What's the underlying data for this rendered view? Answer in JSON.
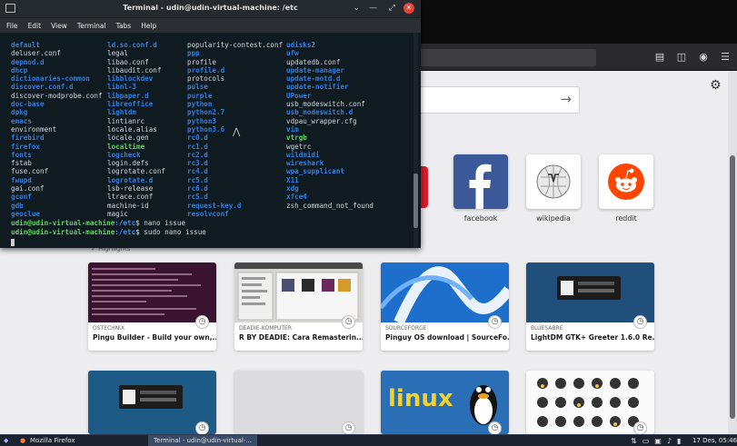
{
  "terminal": {
    "title": "Terminal - udin@udin-virtual-machine: /etc",
    "menu": [
      "File",
      "Edit",
      "View",
      "Terminal",
      "Tabs",
      "Help"
    ],
    "columns": [
      [
        {
          "t": "default",
          "k": "d"
        },
        {
          "t": "deluser.conf",
          "k": "n"
        },
        {
          "t": "depmod.d",
          "k": "d"
        },
        {
          "t": "dhcp",
          "k": "d"
        },
        {
          "t": "dictionaries-common",
          "k": "d"
        },
        {
          "t": "discover.conf.d",
          "k": "d"
        },
        {
          "t": "discover-modprobe.conf",
          "k": "n"
        },
        {
          "t": "doc-base",
          "k": "d"
        },
        {
          "t": "dpkg",
          "k": "d"
        },
        {
          "t": "emacs",
          "k": "d"
        },
        {
          "t": "environment",
          "k": "n"
        },
        {
          "t": "firebird",
          "k": "d"
        },
        {
          "t": "firefox",
          "k": "d"
        },
        {
          "t": "fonts",
          "k": "d"
        },
        {
          "t": "fstab",
          "k": "n"
        },
        {
          "t": "fuse.conf",
          "k": "n"
        },
        {
          "t": "fwupd",
          "k": "d"
        },
        {
          "t": "gai.conf",
          "k": "n"
        },
        {
          "t": "gconf",
          "k": "d"
        },
        {
          "t": "gdb",
          "k": "d"
        },
        {
          "t": "geoclue",
          "k": "d"
        }
      ],
      [
        {
          "t": "ld.so.conf.d",
          "k": "d"
        },
        {
          "t": "legal",
          "k": "n"
        },
        {
          "t": "libao.conf",
          "k": "n"
        },
        {
          "t": "libaudit.conf",
          "k": "n"
        },
        {
          "t": "libblockdev",
          "k": "d"
        },
        {
          "t": "libnl-3",
          "k": "d"
        },
        {
          "t": "libpaper.d",
          "k": "d"
        },
        {
          "t": "libreoffice",
          "k": "d"
        },
        {
          "t": "lightdm",
          "k": "d"
        },
        {
          "t": "lintianrc",
          "k": "n"
        },
        {
          "t": "locale.alias",
          "k": "n"
        },
        {
          "t": "locale.gen",
          "k": "n"
        },
        {
          "t": "localtime",
          "k": "x"
        },
        {
          "t": "logcheck",
          "k": "d"
        },
        {
          "t": "login.defs",
          "k": "n"
        },
        {
          "t": "logrotate.conf",
          "k": "n"
        },
        {
          "t": "logrotate.d",
          "k": "d"
        },
        {
          "t": "lsb-release",
          "k": "n"
        },
        {
          "t": "ltrace.conf",
          "k": "n"
        },
        {
          "t": "machine-id",
          "k": "n"
        },
        {
          "t": "magic",
          "k": "n"
        }
      ],
      [
        {
          "t": "popularity-contest.conf",
          "k": "n"
        },
        {
          "t": "ppp",
          "k": "d"
        },
        {
          "t": "profile",
          "k": "n"
        },
        {
          "t": "profile.d",
          "k": "d"
        },
        {
          "t": "protocols",
          "k": "n"
        },
        {
          "t": "pulse",
          "k": "d"
        },
        {
          "t": "purple",
          "k": "d"
        },
        {
          "t": "python",
          "k": "d"
        },
        {
          "t": "python2.7",
          "k": "d"
        },
        {
          "t": "python3",
          "k": "d"
        },
        {
          "t": "python3.6",
          "k": "d"
        },
        {
          "t": "rc0.d",
          "k": "d"
        },
        {
          "t": "rc1.d",
          "k": "d"
        },
        {
          "t": "rc2.d",
          "k": "d"
        },
        {
          "t": "rc3.d",
          "k": "d"
        },
        {
          "t": "rc4.d",
          "k": "d"
        },
        {
          "t": "rc5.d",
          "k": "d"
        },
        {
          "t": "rc6.d",
          "k": "d"
        },
        {
          "t": "rcS.d",
          "k": "d"
        },
        {
          "t": "request-key.d",
          "k": "d"
        },
        {
          "t": "resolvconf",
          "k": "d"
        }
      ],
      [
        {
          "t": "udisks2",
          "k": "d"
        },
        {
          "t": "ufw",
          "k": "d"
        },
        {
          "t": "updatedb.conf",
          "k": "n"
        },
        {
          "t": "update-manager",
          "k": "d"
        },
        {
          "t": "update-motd.d",
          "k": "d"
        },
        {
          "t": "update-notifier",
          "k": "d"
        },
        {
          "t": "UPower",
          "k": "d"
        },
        {
          "t": "usb_modeswitch.conf",
          "k": "n"
        },
        {
          "t": "usb_modeswitch.d",
          "k": "d"
        },
        {
          "t": "vdpau_wrapper.cfg",
          "k": "n"
        },
        {
          "t": "vim",
          "k": "d"
        },
        {
          "t": "vtrgb",
          "k": "x"
        },
        {
          "t": "wgetrc",
          "k": "n"
        },
        {
          "t": "wildmidi",
          "k": "d"
        },
        {
          "t": "wireshark",
          "k": "d"
        },
        {
          "t": "wpa_supplicant",
          "k": "d"
        },
        {
          "t": "X11",
          "k": "d"
        },
        {
          "t": "xdg",
          "k": "d"
        },
        {
          "t": "xfce4",
          "k": "d"
        },
        {
          "t": "zsh_command_not_found",
          "k": "n"
        },
        {
          "t": "",
          "k": "n"
        }
      ]
    ],
    "prompts": [
      {
        "user": "udin@udin-virtual-machine",
        "path": ":/etc",
        "cmd": "$ nano issue"
      },
      {
        "user": "udin@udin-virtual-machine",
        "path": ":/etc",
        "cmd": "$ sudo nano issue"
      }
    ]
  },
  "firefox": {
    "top_sites": [
      {
        "label": "facebook"
      },
      {
        "label": "wikipedia"
      },
      {
        "label": "reddit"
      }
    ],
    "highlights_heading": "Highlights",
    "highlights": [
      {
        "source": "OSTECHNIX",
        "title": "Pingu Builder - Build your own,..."
      },
      {
        "source": "DEADIE-KOMPUTER",
        "title": "R BY DEADIE: Cara Remasterin..."
      },
      {
        "source": "SOURCEFORGE",
        "title": "Pinguy OS download | SourceFo..."
      },
      {
        "source": "BLUESABRE",
        "title": "LightDM GTK+ Greeter 1.6.0 Re..."
      }
    ],
    "linux_text": "linux"
  },
  "taskbar": {
    "firefox_label": "Mozilla Firefox",
    "terminal_label": "Terminal - udin@udin-virtual-...",
    "clock": "17 Des, 05:46"
  }
}
